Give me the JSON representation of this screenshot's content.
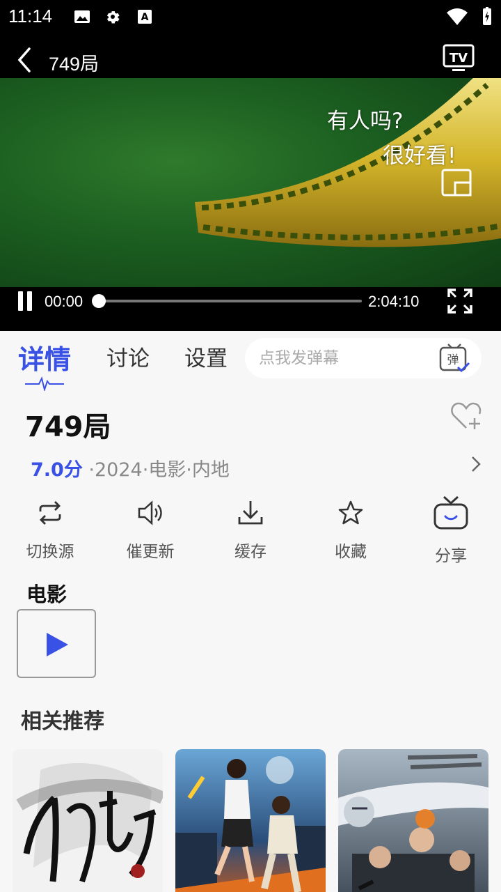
{
  "status_bar": {
    "time": "11:14"
  },
  "header": {
    "title": "749局"
  },
  "video": {
    "danmaku": [
      "有人吗?",
      "很好看!"
    ],
    "current_time": "00:00",
    "total_time": "2:04:10",
    "progress": 0.0
  },
  "tabs": [
    {
      "label": "详情",
      "active": true
    },
    {
      "label": "讨论",
      "active": false
    },
    {
      "label": "设置",
      "active": false
    }
  ],
  "danmaku_input": {
    "placeholder": "点我发弹幕",
    "send_icon_text": "弹"
  },
  "movie": {
    "title": "749局",
    "score": "7.0分",
    "info": " ·2024·电影·内地"
  },
  "actions": [
    {
      "label": "切换源",
      "icon": "switch-source-icon"
    },
    {
      "label": "催更新",
      "icon": "speaker-icon"
    },
    {
      "label": "缓存",
      "icon": "download-icon"
    },
    {
      "label": "收藏",
      "icon": "star-icon"
    },
    {
      "label": "分享",
      "icon": "tv-share-icon"
    }
  ],
  "episodes_section": {
    "title": "电影"
  },
  "recommend_section": {
    "title": "相关推荐"
  },
  "colors": {
    "accent": "#3a51e6",
    "video_green": "#1b5e20",
    "film_gold": "#d4b52a"
  }
}
